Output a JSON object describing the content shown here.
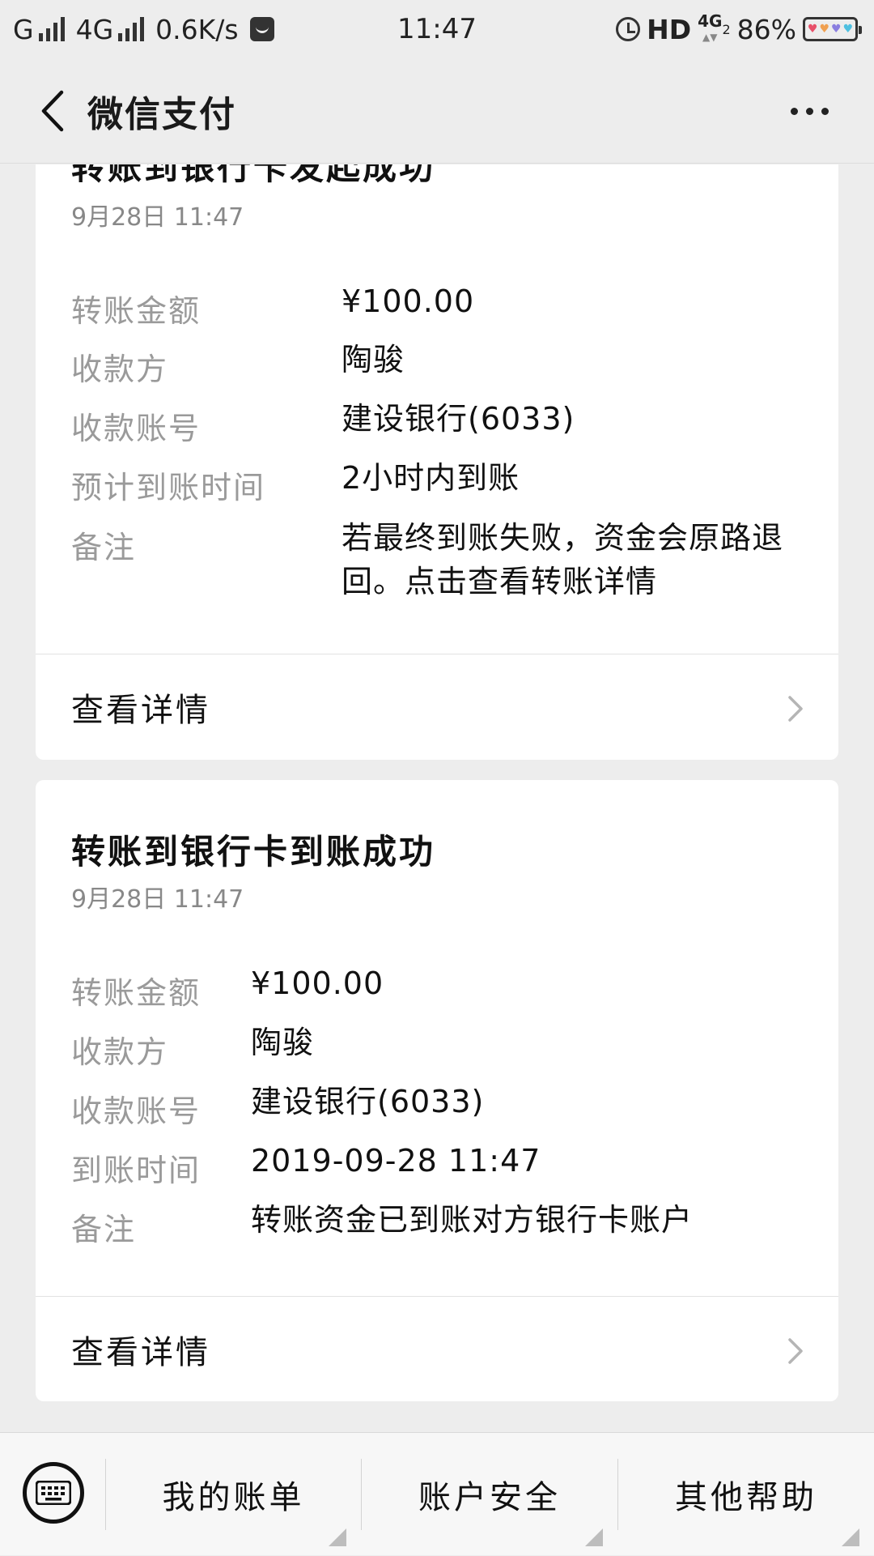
{
  "status_bar": {
    "carrier_left": "G",
    "network": "4G",
    "speed": "0.6K/s",
    "time": "11:47",
    "hd": "HD",
    "network_right": "4G",
    "network_right_sub": "2",
    "battery": "86%"
  },
  "nav": {
    "title": "微信支付"
  },
  "card1": {
    "title": "转账到银行卡发起成功",
    "time": "9月28日 11:47",
    "rows": [
      {
        "label": "转账金额",
        "value": "¥100.00"
      },
      {
        "label": "收款方",
        "value": "陶骏"
      },
      {
        "label": "收款账号",
        "value": "建设银行(6033)"
      },
      {
        "label": "预计到账时间",
        "value": "2小时内到账"
      },
      {
        "label": "备注",
        "value": "若最终到账失败，资金会原路退回。点击查看转账详情"
      }
    ],
    "link": "查看详情"
  },
  "card2": {
    "title": "转账到银行卡到账成功",
    "time": "9月28日 11:47",
    "rows": [
      {
        "label": "转账金额",
        "value": "¥100.00"
      },
      {
        "label": "收款方",
        "value": "陶骏"
      },
      {
        "label": "收款账号",
        "value": "建设银行(6033)"
      },
      {
        "label": "到账时间",
        "value": "2019-09-28 11:47"
      },
      {
        "label": "备注",
        "value": "转账资金已到账对方银行卡账户"
      }
    ],
    "link": "查看详情"
  },
  "bottom_menu": {
    "items": [
      "我的账单",
      "账户安全",
      "其他帮助"
    ]
  }
}
